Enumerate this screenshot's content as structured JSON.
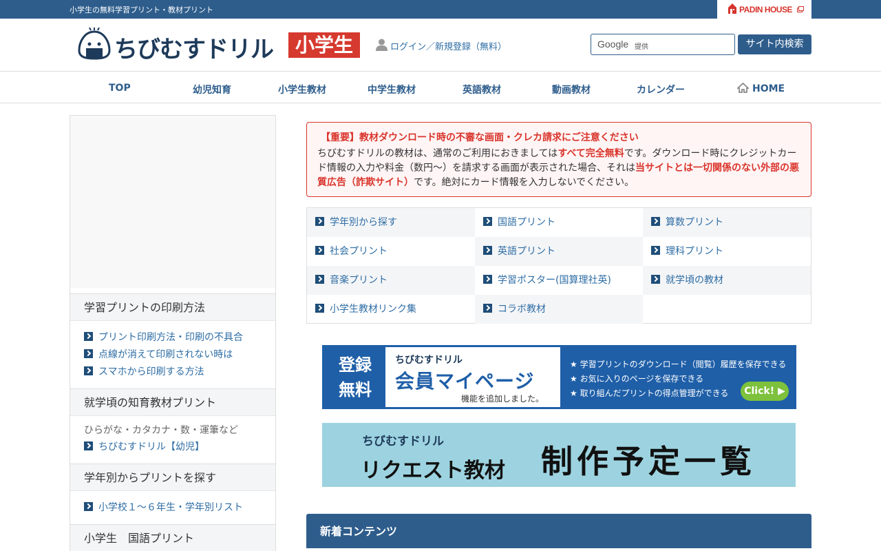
{
  "topbar": {
    "tagline": "小学生の無料学習プリント・教材プリント",
    "partner": "PADIN HOUSE"
  },
  "header": {
    "logo_name": "ちびむすドリル",
    "logo_grade": "小学生",
    "login": "ログイン／新規登録（無料）",
    "search_brand": "Google",
    "search_suffix": "提供",
    "search_button": "サイト内検索"
  },
  "nav": {
    "items": [
      "TOP",
      "幼児知育",
      "小学生教材",
      "中学生教材",
      "英語教材",
      "動画教材",
      "カレンダー",
      "HOME"
    ]
  },
  "sidebar": {
    "sections": [
      {
        "title": "学習プリントの印刷方法",
        "links": [
          "プリント印刷方法・印刷の不具合",
          "点線が消えて印刷されない時は",
          "スマホから印刷する方法"
        ]
      },
      {
        "title": "就学頃の知育教材プリント",
        "note": "ひらがな・カタカナ・数・運筆など",
        "links": [
          "ちびむすドリル【幼児】"
        ]
      },
      {
        "title": "学年別からプリントを探す",
        "links": [
          "小学校１～６年生・学年別リスト"
        ]
      },
      {
        "title": "小学生　国語プリント"
      }
    ]
  },
  "notice": {
    "title": "【重要】教材ダウンロード時の不審な画面・クレカ請求にご注意ください",
    "p1": "ちびむすドリルの教材は、通常のご利用におきましては",
    "p1_red": "すべて完全無料",
    "p2": "です。ダウンロード時にクレジットカード情報の入力や料金（数円～）を請求する画面が表示された場合、それは",
    "p2_red": "当サイトとは一切関係のない外部の悪質広告（詐欺サイト）",
    "p3": "です。絶対にカード情報を入力しないでください。"
  },
  "categories": [
    "学年別から探す",
    "国語プリント",
    "算数プリント",
    "社会プリント",
    "英語プリント",
    "理科プリント",
    "音楽プリント",
    "学習ポスター(国算理社英)",
    "就学頃の教材",
    "小学生教材リンク集",
    "コラボ教材"
  ],
  "banner_member": {
    "left_line1": "登録",
    "left_line2": "無料",
    "brand": "ちびむすドリル",
    "title": "会員マイページ",
    "subtitle": "機能を追加しました。",
    "features": [
      "★ 学習プリントのダウンロード（閲覧）履歴を保存できる",
      "★ お気に入りのページを保存できる",
      "★ 取り組んだプリントの得点管理ができる"
    ],
    "click": "Click! ▶"
  },
  "banner_request": {
    "brand": "ちびむすドリル",
    "title": "リクエスト教材",
    "plan": "制作予定一覧"
  },
  "new_contents": {
    "title": "新着コンテンツ"
  },
  "colors": {
    "primary": "#2e5d8c",
    "accent_red": "#d9342b",
    "link": "#2e6da4"
  }
}
